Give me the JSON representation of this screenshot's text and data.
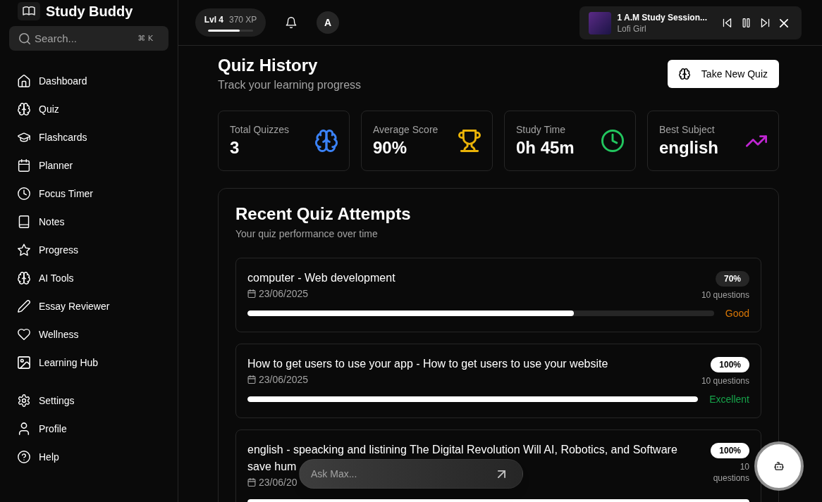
{
  "sidebar": {
    "app_name": "Study Buddy",
    "search": {
      "placeholder": "Search...",
      "shortcut": "⌘ K"
    },
    "nav_items": [
      "Dashboard",
      "Quiz",
      "Flashcards",
      "Planner",
      "Focus Timer",
      "Notes",
      "Progress",
      "AI Tools",
      "Essay Reviewer",
      "Wellness",
      "Learning Hub"
    ],
    "footer_items": [
      "Settings",
      "Profile",
      "Help"
    ]
  },
  "header": {
    "xp": {
      "label": "Lvl 4",
      "points": "370 XP",
      "level": 0.7
    },
    "avatar": "A",
    "player": {
      "title": "1 A.M Study Session...",
      "artist": "Lofi Girl"
    }
  },
  "page": {
    "title": "Quiz History",
    "subtitle": "Track your learning progress",
    "action": "Take New Quiz"
  },
  "stats": [
    {
      "label": "Total Quizzes",
      "value": "3",
      "color": "#3b82f6"
    },
    {
      "label": "Average Score",
      "value": "90%",
      "color": "#eab308"
    },
    {
      "label": "Study Time",
      "value": "0h 45m",
      "color": "#22c55e"
    },
    {
      "label": "Best Subject",
      "value": "english",
      "color": "#c026d3"
    }
  ],
  "recent": {
    "title": "Recent Quiz Attempts",
    "subtitle": "Your quiz performance over time",
    "attempts": [
      {
        "title_lines": [
          "computer - Web development"
        ],
        "date": "23/06/2025",
        "score": "70%",
        "questions": "10 questions",
        "level": 0.7,
        "rating": "Good",
        "color": "#d97706"
      },
      {
        "title_lines": [
          "How to get users to use your app - How to get users to use your website"
        ],
        "date": "23/06/2025",
        "score": "100%",
        "questions": "10 questions",
        "level": 1,
        "rating": "Excellent",
        "color": "#16a34a"
      },
      {
        "title_lines": [
          "english - speacking and listining The Digital Revolution Will AI, Robotics, and Software",
          "save hum"
        ],
        "date": "23/06/20",
        "score": "100%",
        "questions": "10 questions",
        "level": 1
      }
    ]
  },
  "assistant": {
    "placeholder": "Ask Max..."
  }
}
